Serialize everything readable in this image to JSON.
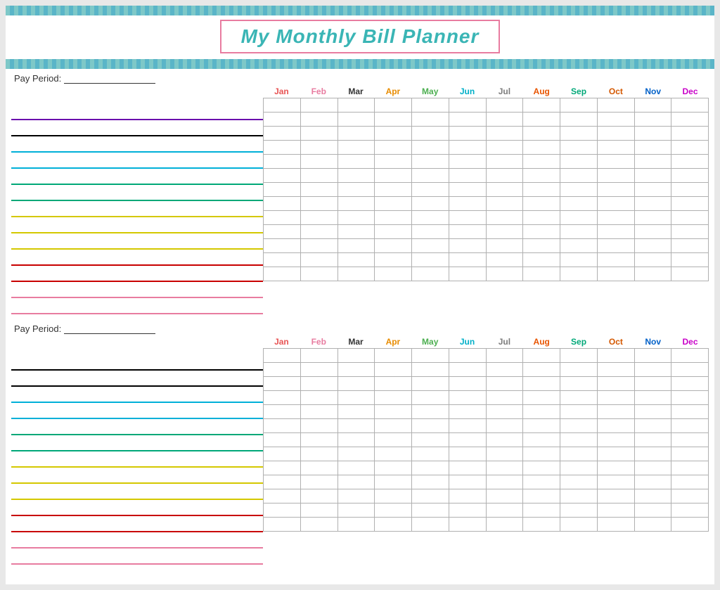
{
  "header": {
    "title": "My Monthly Bill Planner"
  },
  "months": [
    {
      "label": "Jan",
      "class": "jan"
    },
    {
      "label": "Feb",
      "class": "feb"
    },
    {
      "label": "Mar",
      "class": "mar"
    },
    {
      "label": "Apr",
      "class": "apr"
    },
    {
      "label": "May",
      "class": "may"
    },
    {
      "label": "Jun",
      "class": "jun"
    },
    {
      "label": "Jul",
      "class": "jul"
    },
    {
      "label": "Aug",
      "class": "aug"
    },
    {
      "label": "Sep",
      "class": "sep"
    },
    {
      "label": "Oct",
      "class": "oct"
    },
    {
      "label": "Nov",
      "class": "nov"
    },
    {
      "label": "Dec",
      "class": "dec"
    }
  ],
  "sections": [
    {
      "id": "section1",
      "pay_period_label": "Pay Period:",
      "rows": 13,
      "line_colors": [
        "#6a0dad",
        "#000000",
        "#00b0d8",
        "#00b0d8",
        "#00a878",
        "#00a878",
        "#d4c800",
        "#d4c800",
        "#d4c800",
        "#c80000",
        "#c80000",
        "#e87ca0",
        "#e87ca0"
      ]
    },
    {
      "id": "section2",
      "pay_period_label": "Pay Period:",
      "rows": 13,
      "line_colors": [
        "#000000",
        "#000000",
        "#00b0d8",
        "#00b0d8",
        "#00a878",
        "#00a878",
        "#d4c800",
        "#d4c800",
        "#d4c800",
        "#c80000",
        "#c80000",
        "#e87ca0",
        "#e87ca0"
      ]
    }
  ]
}
